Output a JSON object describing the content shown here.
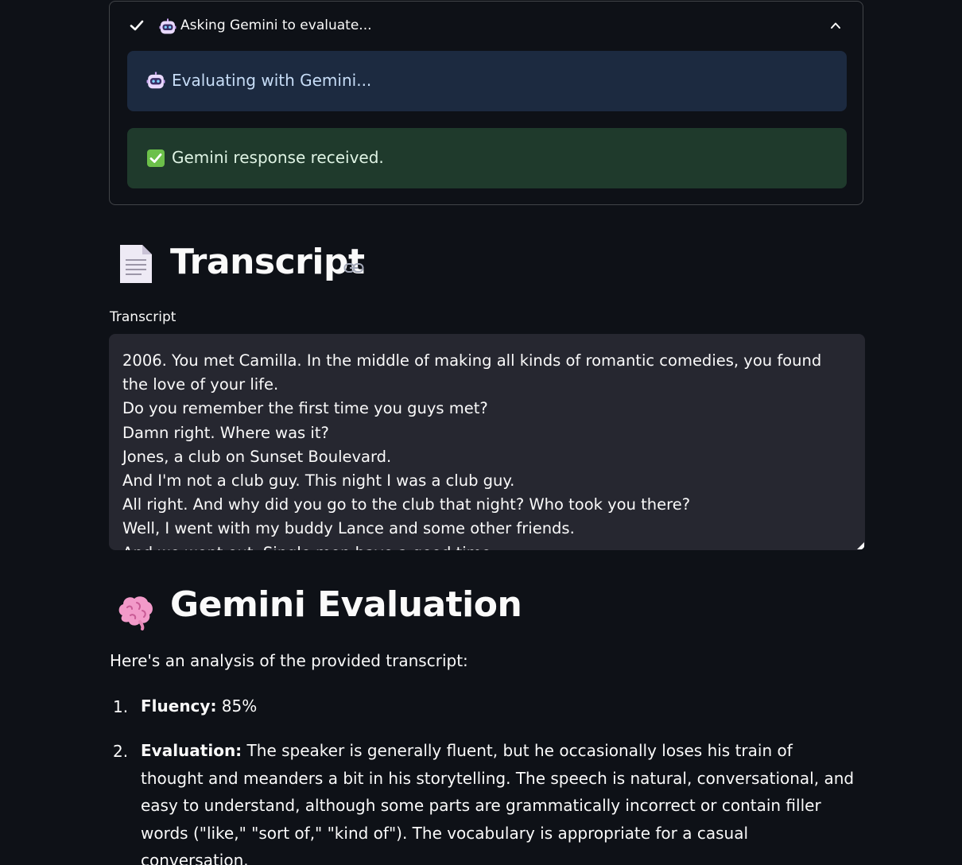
{
  "status": {
    "title": "Asking Gemini to evaluate...",
    "info_message": "Evaluating with Gemini...",
    "success_message": "Gemini response received."
  },
  "transcript_section": {
    "heading": "Transcript",
    "field_label": "Transcript",
    "text": "2006. You met Camilla. In the middle of making all kinds of romantic comedies, you found the love of your life.\nDo you remember the first time you guys met?\nDamn right. Where was it?\nJones, a club on Sunset Boulevard.\nAnd I'm not a club guy. This night I was a club guy.\nAll right. And why did you go to the club that night? Who took you there?\nWell, I went with my buddy Lance and some other friends.\nAnd we went out. Single men have a good time."
  },
  "evaluation_section": {
    "heading": "Gemini Evaluation",
    "intro": "Here's an analysis of the provided transcript:",
    "items": [
      {
        "number": "1.",
        "label": "Fluency:",
        "text": " 85%"
      },
      {
        "number": "2.",
        "label": "Evaluation:",
        "text": " The speaker is generally fluent, but he occasionally loses his train of thought and meanders a bit in his storytelling. The speech is natural, conversational, and easy to understand, although some parts are grammatically incorrect or contain filler words (\"like,\" \"sort of,\" \"kind of\"). The vocabulary is appropriate for a casual conversation."
      }
    ]
  },
  "icons": {
    "status_check": "check-icon",
    "robot": "robot-icon",
    "collapse": "chevron-up-icon",
    "success": "green-check-box-icon",
    "transcript": "document-icon",
    "evaluation": "brain-icon",
    "anchor": "link-icon"
  },
  "colors": {
    "background": "#0e1117",
    "info_bg": "#1c2a40",
    "success_bg": "#1f3a2c",
    "textarea_bg": "#262730"
  }
}
